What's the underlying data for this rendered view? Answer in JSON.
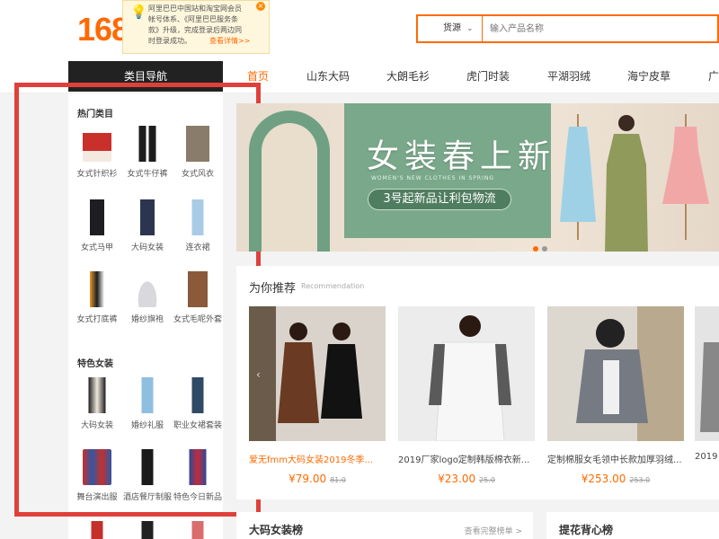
{
  "header": {
    "logo": "168",
    "tooltip": {
      "lines": [
        "阿里巴巴中国站和淘宝网会员",
        "帐号体系、《阿里巴巴服务条",
        "款》升级，完成登录后两边同",
        "时登录成功。"
      ],
      "link": "查看详情>>"
    },
    "search": {
      "source_label": "货源",
      "placeholder": "输入产品名称"
    }
  },
  "nav": {
    "category_label": "类目导航",
    "items": [
      "首页",
      "山东大码",
      "大朗毛衫",
      "虎门时装",
      "平湖羽绒",
      "海宁皮草",
      "广"
    ]
  },
  "categories": {
    "hot_title": "热门类目",
    "hot": [
      {
        "label": "女式针织衫",
        "icon": "knit-sweater-thumbnail"
      },
      {
        "label": "女式牛仔裤",
        "icon": "jeans-thumbnail"
      },
      {
        "label": "女式风衣",
        "icon": "trench-coat-thumbnail"
      },
      {
        "label": "女式马甲",
        "icon": "vest-thumbnail"
      },
      {
        "label": "大码女装",
        "icon": "plus-size-thumbnail"
      },
      {
        "label": "连衣裙",
        "icon": "dress-thumbnail"
      },
      {
        "label": "女式打底裤",
        "icon": "leggings-thumbnail"
      },
      {
        "label": "婚纱旗袍",
        "icon": "wedding-dress-thumbnail"
      },
      {
        "label": "女式毛呢外套",
        "icon": "wool-coat-thumbnail"
      }
    ],
    "special_title": "特色女装",
    "special": [
      {
        "label": "大码女装",
        "icon": "plus-size-dress-thumbnail"
      },
      {
        "label": "婚纱礼服",
        "icon": "gown-thumbnail"
      },
      {
        "label": "职业女裙套装",
        "icon": "work-suit-thumbnail"
      },
      {
        "label": "舞台演出服",
        "icon": "stage-costume-thumbnail"
      },
      {
        "label": "酒店餐厅制服",
        "icon": "uniform-thumbnail"
      },
      {
        "label": "特色今日新品",
        "icon": "cape-thumbnail"
      }
    ]
  },
  "banner": {
    "title": "女装春上新",
    "subtitle": "WOMEN'S NEW CLOTHES IN SPRING",
    "promo": "3号起新品让利包物流"
  },
  "recommend": {
    "title": "为你推荐",
    "title_en": "Recommendation",
    "products": [
      {
        "name": "爱无fmm大码女装2019冬季...",
        "price": "¥79.00",
        "old_price": "81.0",
        "hot": true
      },
      {
        "name": "2019厂家logo定制韩版棉衣新...",
        "price": "¥23.00",
        "old_price": "25.0",
        "hot": false
      },
      {
        "name": "定制棉服女毛领中长款加厚羽绒...",
        "price": "¥253.00",
        "old_price": "253.0",
        "hot": false
      },
      {
        "name": "2019",
        "price": "",
        "old_price": "",
        "hot": false
      }
    ]
  },
  "boards": [
    {
      "title": "大码女装榜",
      "link": "查看完整榜单 >"
    },
    {
      "title": "提花背心榜",
      "link": ""
    }
  ],
  "colors": {
    "brand": "#ff6a00",
    "highlight_border": "#e0403b",
    "banner_green": "#7aa88a"
  }
}
